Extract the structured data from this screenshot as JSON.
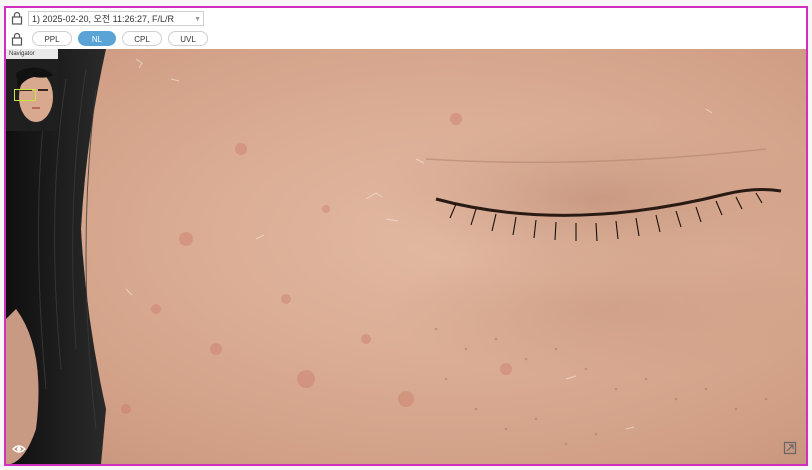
{
  "header": {
    "session_value": "1) 2025-02-20, 오전 11:26:27, F/L/R"
  },
  "modes": [
    {
      "label": "PPL",
      "active": false
    },
    {
      "label": "NL",
      "active": true
    },
    {
      "label": "CPL",
      "active": false
    },
    {
      "label": "UVL",
      "active": false
    }
  ],
  "navigator": {
    "label": "Navigator"
  },
  "icons": {
    "lock": "lock-icon",
    "eye": "eye-icon",
    "compare": "compare-icon"
  },
  "colors": {
    "border_accent": "#d12fbf",
    "active_mode": "#5aa3d6",
    "viewport_box": "#c8e63a"
  }
}
